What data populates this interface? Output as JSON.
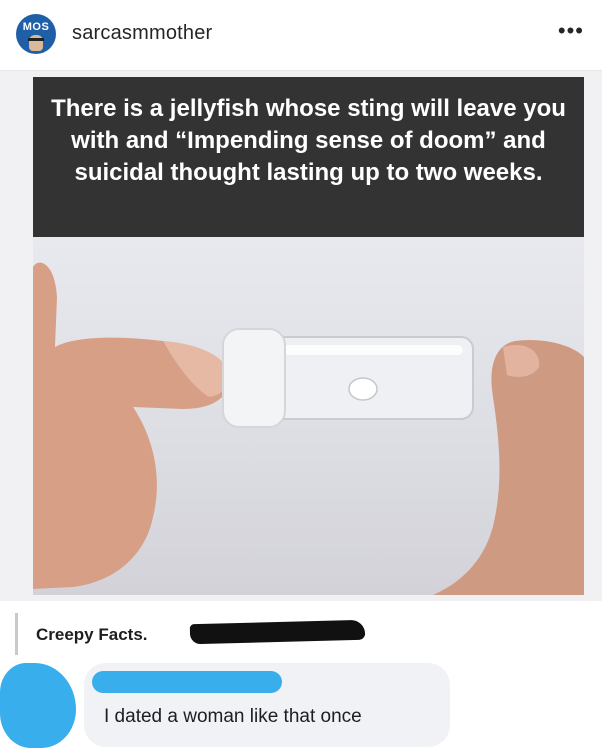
{
  "header": {
    "avatar_text": "MOS",
    "username": "sarcasmmother",
    "more_label": "•••"
  },
  "post": {
    "caption": "There is a jellyfish whose sting will leave you with and “Impending sense of doom” and suicidal thought lasting up to two weeks."
  },
  "comment_section": {
    "source_name": "Creepy Facts.",
    "comment": "I dated a woman like that once"
  },
  "colors": {
    "banner": "#333333",
    "redaction_blue": "#39aeed",
    "bubble": "#f0f2f5",
    "avatar_brand": "#1f5fa8"
  }
}
